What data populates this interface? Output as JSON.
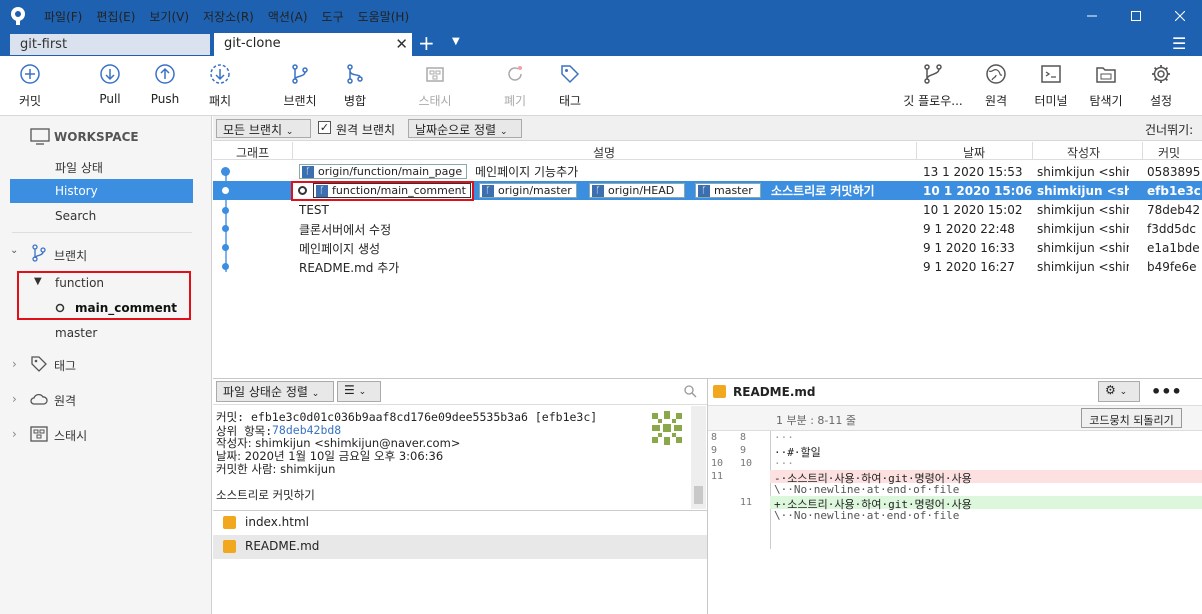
{
  "menu": [
    "파일(F)",
    "편집(E)",
    "보기(V)",
    "저장소(R)",
    "액션(A)",
    "도구",
    "도움말(H)"
  ],
  "tabs": {
    "first": "git-first",
    "second": "git-clone"
  },
  "toolbar": {
    "commit": "커밋",
    "pull": "Pull",
    "push": "Push",
    "fetch": "패치",
    "branch": "브랜치",
    "merge": "병합",
    "stash": "스태시",
    "discard": "폐기",
    "tag": "태그",
    "gitflow": "깃 플로우...",
    "remote": "원격",
    "terminal": "터미널",
    "explorer": "탐색기",
    "settings": "설정"
  },
  "sidebar": {
    "workspace": "WORKSPACE",
    "file_status": "파일 상태",
    "history": "History",
    "search": "Search",
    "branches": "브랜치",
    "branch_function": "function",
    "branch_main_comment": "main_comment",
    "branch_master": "master",
    "tags": "태그",
    "remotes": "원격",
    "stashes": "스태시"
  },
  "filter": {
    "all_branches": "모든 브랜치",
    "remote_branches": "원격 브랜치",
    "sort_date": "날짜순으로 정렬",
    "skip": "건너뛰기:"
  },
  "columns": {
    "graph": "그래프",
    "desc": "설명",
    "date": "날짜",
    "author": "작성자",
    "commit": "커밋"
  },
  "commits": [
    {
      "tags": [
        "origin/function/main_page"
      ],
      "message": "메인페이지 기능추가",
      "date": "13 1 2020 15:53",
      "author": "shimkijun <shimki",
      "hash": "0583895"
    },
    {
      "tags": [
        "function/main_comment",
        "origin/master",
        "origin/HEAD",
        "master"
      ],
      "message": "소스트리로 커밋하기",
      "date": "10 1 2020 15:06",
      "author": "shimkijun <shimki",
      "hash": "efb1e3c"
    },
    {
      "tags": [],
      "message": "TEST",
      "date": "10 1 2020 15:02",
      "author": "shimkijun <shimki",
      "hash": "78deb42"
    },
    {
      "tags": [],
      "message": "클론서버에서 수정",
      "date": "9 1 2020 22:48",
      "author": "shimkijun <shimki",
      "hash": "f3dd5dc"
    },
    {
      "tags": [],
      "message": "메인페이지 생성",
      "date": "9 1 2020 16:33",
      "author": "shimkijun <shimki",
      "hash": "e1a1bde"
    },
    {
      "tags": [],
      "message": "README.md 추가",
      "date": "9 1 2020 16:27",
      "author": "shimkijun <shimki",
      "hash": "b49fe6e"
    }
  ],
  "details": {
    "sort": "파일 상태순 정렬",
    "commit_line": "커밋: efb1e3c0d01c036b9aaf8cd176e09dee5535b3a6 [efb1e3c]",
    "parent_label": "상위 항목:",
    "parent_hash": "78deb42bd8",
    "author_line": "작성자: shimkijun <shimkijun@naver.com>",
    "date_line": "날짜: 2020년 1월 10일 금요일 오후 3:06:36",
    "committer_line": "커밋한 사람: shimkijun",
    "message": "소스트리로 커밋하기",
    "files": [
      "index.html",
      "README.md"
    ]
  },
  "diff": {
    "file": "README.md",
    "hunk": "1 부분 : 8-11 줄",
    "revert": "코드뭉치 되돌리기",
    "lines": [
      {
        "l": "8",
        "r": "8",
        "text": "···",
        "type": "ctx"
      },
      {
        "l": "9",
        "r": "9",
        "text": "··#·할일",
        "type": "ctx"
      },
      {
        "l": "10",
        "r": "10",
        "text": "···",
        "type": "ctx"
      },
      {
        "l": "11",
        "r": "",
        "text": "-·소스트리·사용·하여·git·명령어·사용",
        "type": "del"
      },
      {
        "l": "",
        "r": "",
        "text": "\\··No·newline·at·end·of·file",
        "type": "ctx"
      },
      {
        "l": "",
        "r": "11",
        "text": "+·소스트리·사용·하여·git·명령어·사용",
        "type": "add"
      },
      {
        "l": "",
        "r": "",
        "text": "\\··No·newline·at·end·of·file",
        "type": "ctx"
      }
    ]
  }
}
